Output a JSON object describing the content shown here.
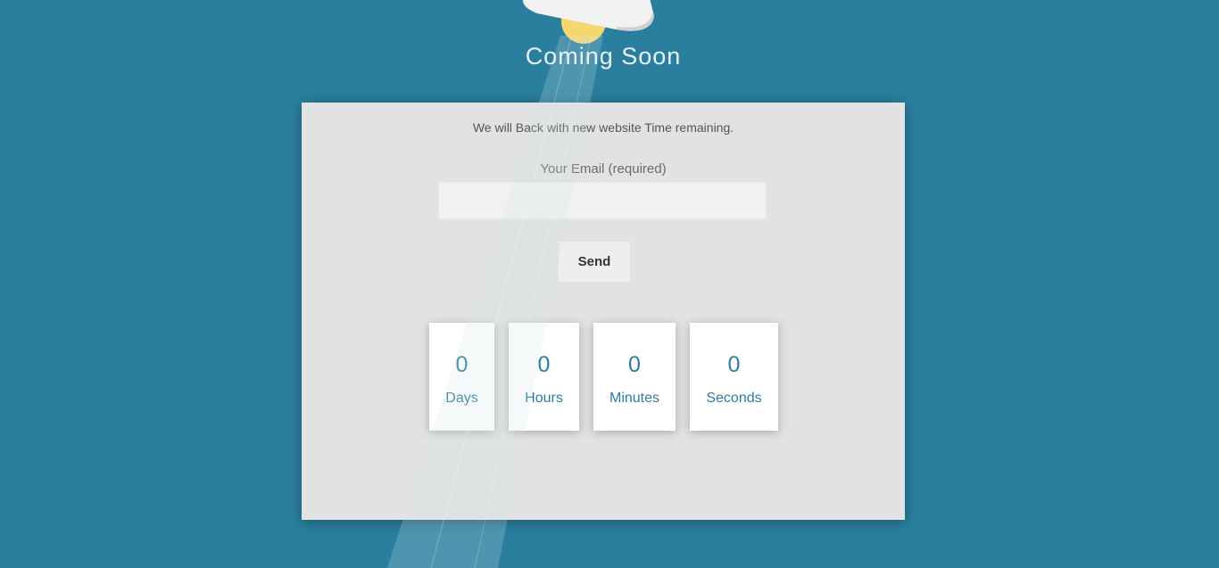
{
  "header": {
    "title": "Coming Soon"
  },
  "card": {
    "message": "We will Back with new website Time remaining.",
    "email_label": "Your Email (required)",
    "email_value": "",
    "send_label": "Send"
  },
  "countdown": {
    "days": {
      "value": "0",
      "label": "Days"
    },
    "hours": {
      "value": "0",
      "label": "Hours"
    },
    "minutes": {
      "value": "0",
      "label": "Minutes"
    },
    "seconds": {
      "value": "0",
      "label": "Seconds"
    }
  },
  "colors": {
    "background": "#2a7f9f",
    "card": "#e2e2e2",
    "accent": "#2a7f9f",
    "bulb": "#f5d76e",
    "lamp_shade": "#f0f0f0"
  },
  "icons": {
    "lamp": "ceiling-lamp-icon",
    "bulb": "light-bulb-icon",
    "beam": "light-beam"
  }
}
